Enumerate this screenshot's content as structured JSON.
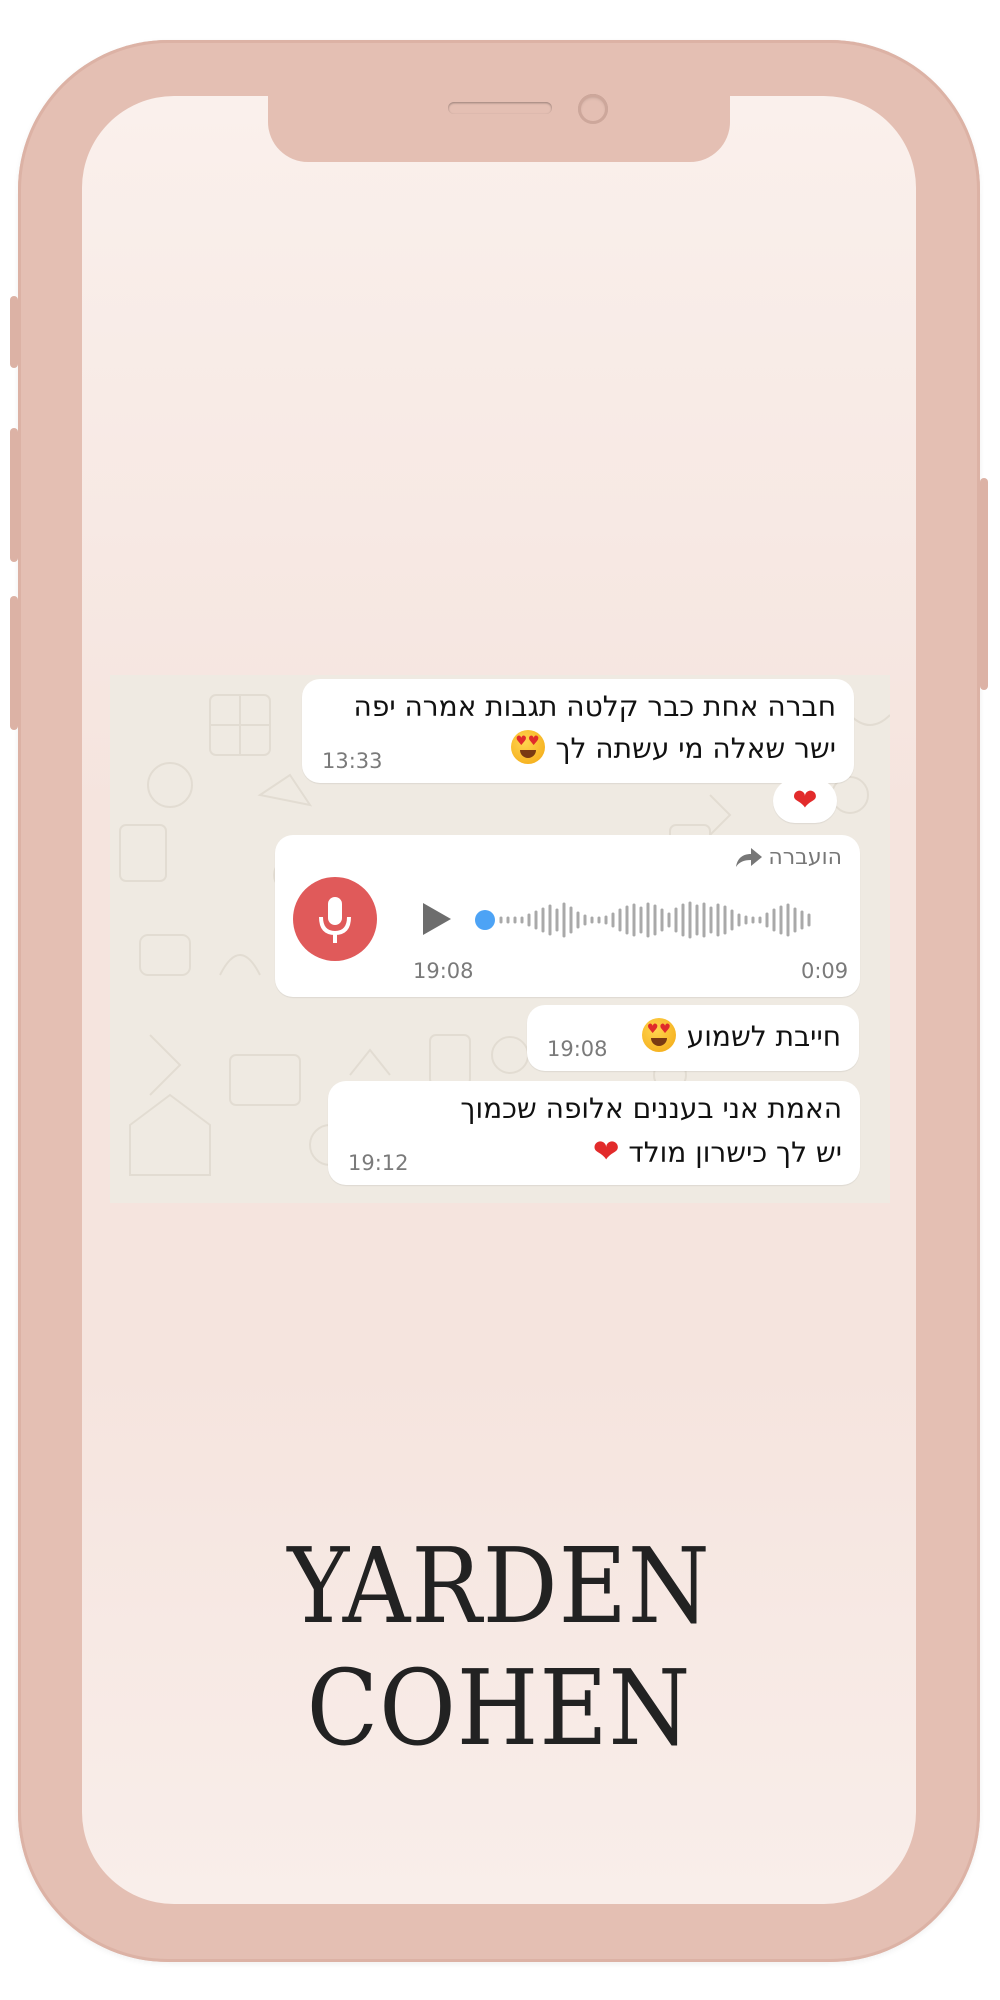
{
  "chat": {
    "messages": [
      {
        "line1": "חברה אחת כבר קלטה תגבות אמרה יפה",
        "line2": "ישר שאלה מי עשתה לך",
        "time": "13:33"
      },
      {
        "forward_label": "הועברה",
        "type": "voice",
        "duration": "0:09",
        "time": "19:08"
      },
      {
        "line1": "חייבת לשמוע",
        "time": "19:08"
      },
      {
        "line1": "האמת אני בעננים אלופה שכמוך",
        "line2": "יש לך כישרון מולד",
        "time": "19:12"
      }
    ],
    "reaction": "❤"
  },
  "brand": {
    "name": "YARDEN COHEN"
  },
  "colors": {
    "frame": "#e4bfb3",
    "screen": "#f5e4de",
    "chat_bg": "#efeae2",
    "mic": "#e05a5a",
    "dot": "#4da3f5"
  },
  "icons": [
    "mic-icon",
    "play-icon",
    "forward-icon",
    "heart-eyes-emoji",
    "heart-emoji"
  ]
}
